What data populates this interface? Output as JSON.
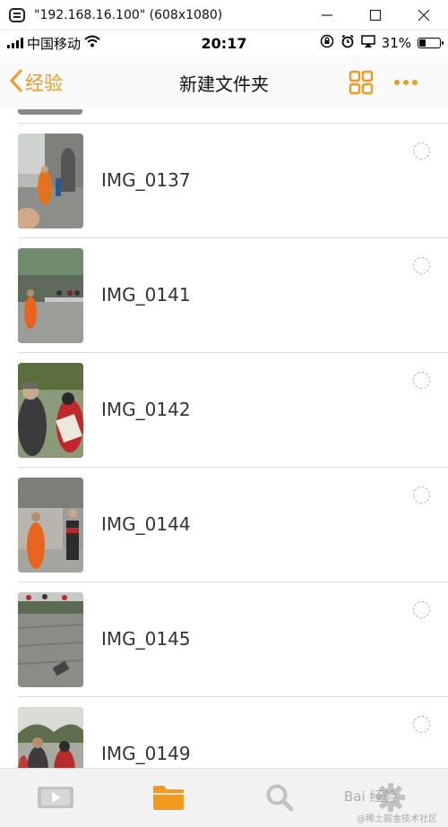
{
  "window": {
    "title": "\"192.168.16.100\" (608x1080)"
  },
  "status_bar": {
    "carrier": "中国移动",
    "time": "20:17",
    "battery": "31%",
    "battery_level": 0.31
  },
  "nav": {
    "back_label": "经验",
    "title": "新建文件夹"
  },
  "items": [
    {
      "name": "IMG_0137"
    },
    {
      "name": "IMG_0141"
    },
    {
      "name": "IMG_0142"
    },
    {
      "name": "IMG_0144"
    },
    {
      "name": "IMG_0145"
    },
    {
      "name": "IMG_0149"
    }
  ],
  "tab_bar": {
    "tabs": [
      {
        "icon": "video-icon",
        "active": false
      },
      {
        "icon": "folder-icon",
        "active": true
      },
      {
        "icon": "search-icon",
        "active": false
      },
      {
        "icon": "gear-icon",
        "active": false
      }
    ]
  },
  "watermarks": {
    "main": "Bai 经验",
    "sub": "@稀土掘金技术社区"
  },
  "colors": {
    "accent": "#f29a1e",
    "divider": "#dddddd",
    "tab_inactive": "#c2c2c2"
  }
}
